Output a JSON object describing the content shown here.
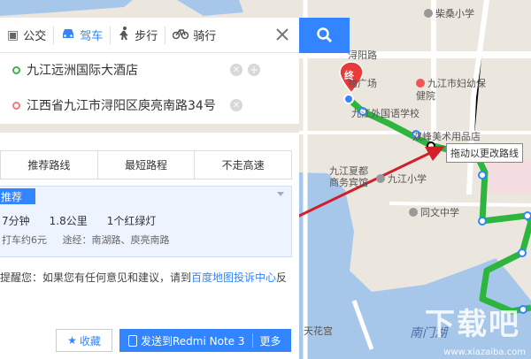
{
  "modes": [
    {
      "label": "公交",
      "icon": "bus-icon",
      "active": false
    },
    {
      "label": "驾车",
      "icon": "car-icon",
      "active": true
    },
    {
      "label": "步行",
      "icon": "walk-icon",
      "active": false
    },
    {
      "label": "骑行",
      "icon": "bike-icon",
      "active": false
    }
  ],
  "start": "九江远洲国际大酒店",
  "end": "江西省九江市浔阳区庾亮南路34号",
  "route_tabs": [
    "推荐路线",
    "最短路程",
    "不走高速"
  ],
  "route": {
    "badge": "推荐",
    "time": "7分钟",
    "distance": "1.8公里",
    "lights": "1个红绿灯",
    "taxi": "打车约6元",
    "via": "途经：南湖路、庾亮南路"
  },
  "note": {
    "prefix": "提醒您：如果您有任何意见和建议，请到",
    "link": "百度地图投诉中心",
    "suffix": "反"
  },
  "footer": {
    "fav": "收藏",
    "send": "发送到Redmi Note 3",
    "more": "更多"
  },
  "tooltip": "拖动以更改路线",
  "map_labels": {
    "marker_end": "终",
    "school1": "柴桑小学",
    "road1": "浔阳路",
    "mall": "物广场",
    "hospital": "九江市妇幼保健院",
    "school2": "九江外国语学校",
    "shop": "双峰美术用品店",
    "park": "九江夏都商务宾馆",
    "school3": "九江小学",
    "school4": "同文中学",
    "lake": "南门湖",
    "temple": "天花宫",
    "watermark": "下载吧",
    "watersite": "www.xiazaiba.com"
  },
  "colors": {
    "accent": "#3385ff",
    "route": "#2db53e",
    "arrow": "#d0202a"
  }
}
